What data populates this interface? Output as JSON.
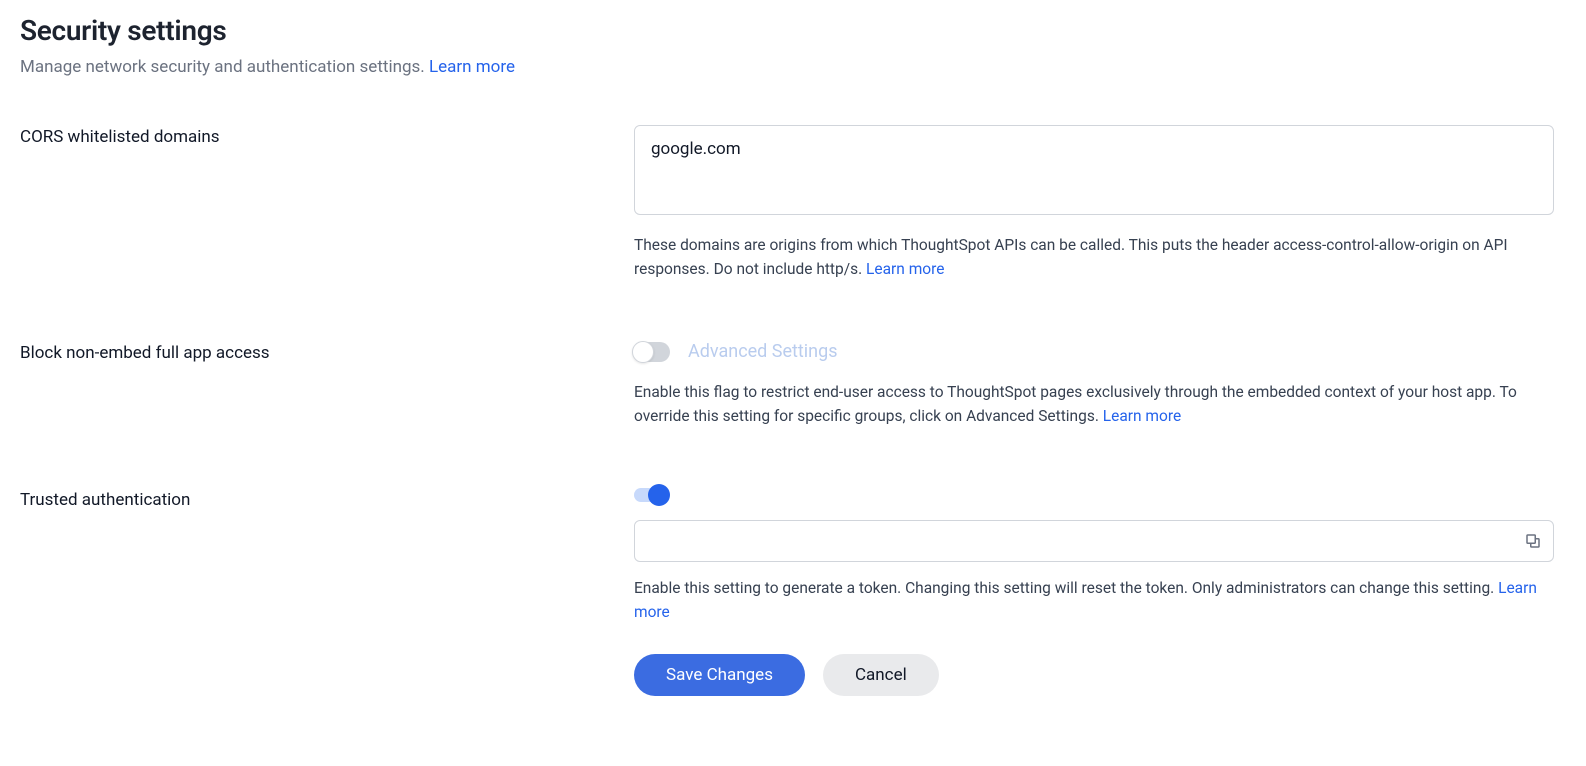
{
  "header": {
    "title": "Security settings",
    "subtitle": "Manage network security and authentication settings.",
    "learn_more": "Learn more"
  },
  "cors": {
    "label": "CORS whitelisted domains",
    "value": "google.com",
    "help": "These domains are origins from which ThoughtSpot APIs can be called. This puts the header access-control-allow-origin on API responses. Do not include http/s.",
    "learn_more": "Learn more"
  },
  "block_embed": {
    "label": "Block non-embed full app access",
    "toggle_on": false,
    "advanced_link": "Advanced Settings",
    "help": "Enable this flag to restrict end-user access to ThoughtSpot pages exclusively through the embedded context of your host app. To override this setting for specific groups, click on Advanced Settings.",
    "learn_more": "Learn more"
  },
  "trusted_auth": {
    "label": "Trusted authentication",
    "toggle_on": true,
    "token_value": "",
    "help": "Enable this setting to generate a token. Changing this setting will reset the token. Only administrators can change this setting.",
    "learn_more": "Learn more"
  },
  "buttons": {
    "save": "Save Changes",
    "cancel": "Cancel"
  }
}
